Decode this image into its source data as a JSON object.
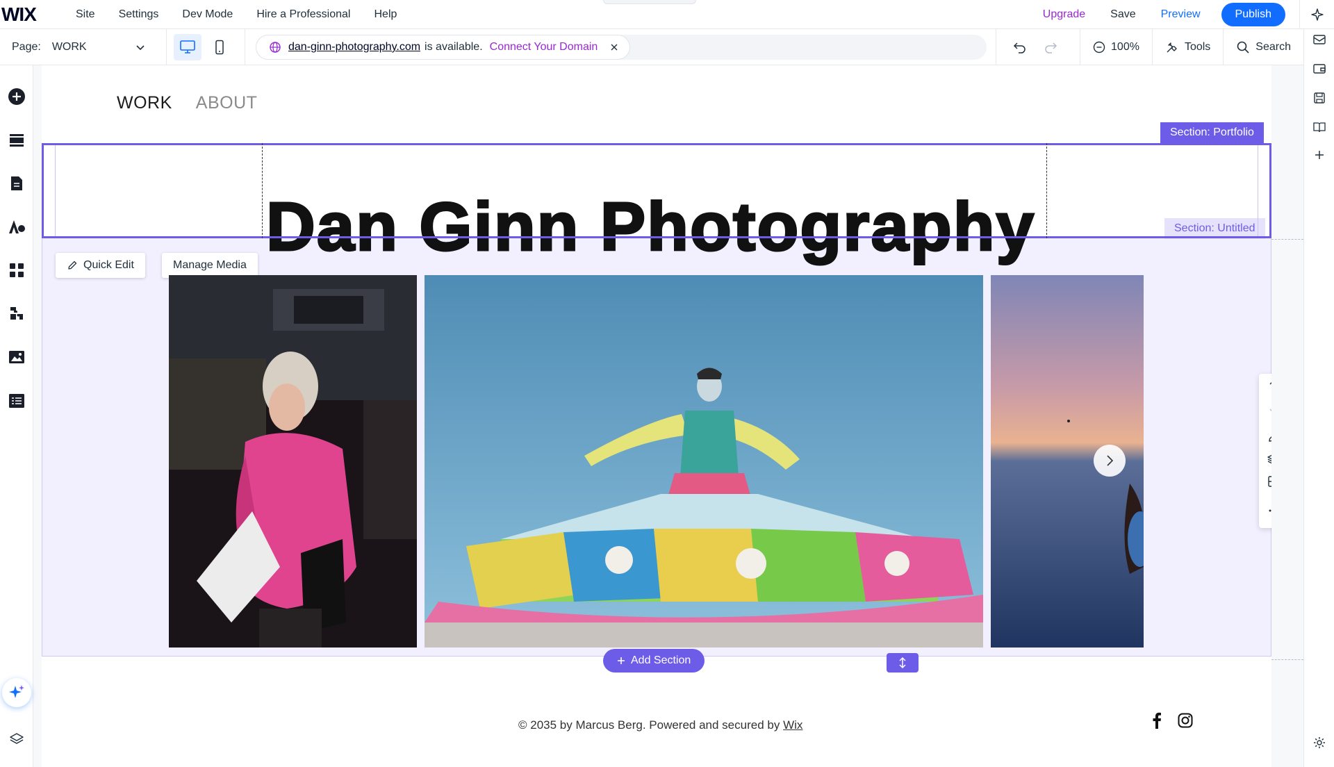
{
  "topbar": {
    "logo": "WIX",
    "menu": [
      "Site",
      "Settings",
      "Dev Mode",
      "Hire a Professional",
      "Help"
    ],
    "upgrade": "Upgrade",
    "save": "Save",
    "preview": "Preview",
    "publish": "Publish"
  },
  "toolbar": {
    "page_label": "Page:",
    "page_value": "WORK",
    "domain": "dan-ginn-photography.com",
    "domain_status": "is available.",
    "connect": "Connect Your Domain",
    "zoom": "100%",
    "tools": "Tools",
    "search": "Search"
  },
  "site": {
    "nav": [
      "WORK",
      "ABOUT"
    ],
    "title": "Dan Ginn Photography",
    "section_portfolio": "Section: Portfolio",
    "section_untitled": "Section: Untitled",
    "quick_edit": "Quick Edit",
    "manage_media": "Manage Media",
    "add_section": "Add Section",
    "footer_text": "© 2035 by Marcus Berg. Powered and secured by",
    "footer_link": "Wix"
  },
  "colors": {
    "accent": "#116dff",
    "section": "#6c5ce7",
    "upgrade": "#9a27d5"
  }
}
